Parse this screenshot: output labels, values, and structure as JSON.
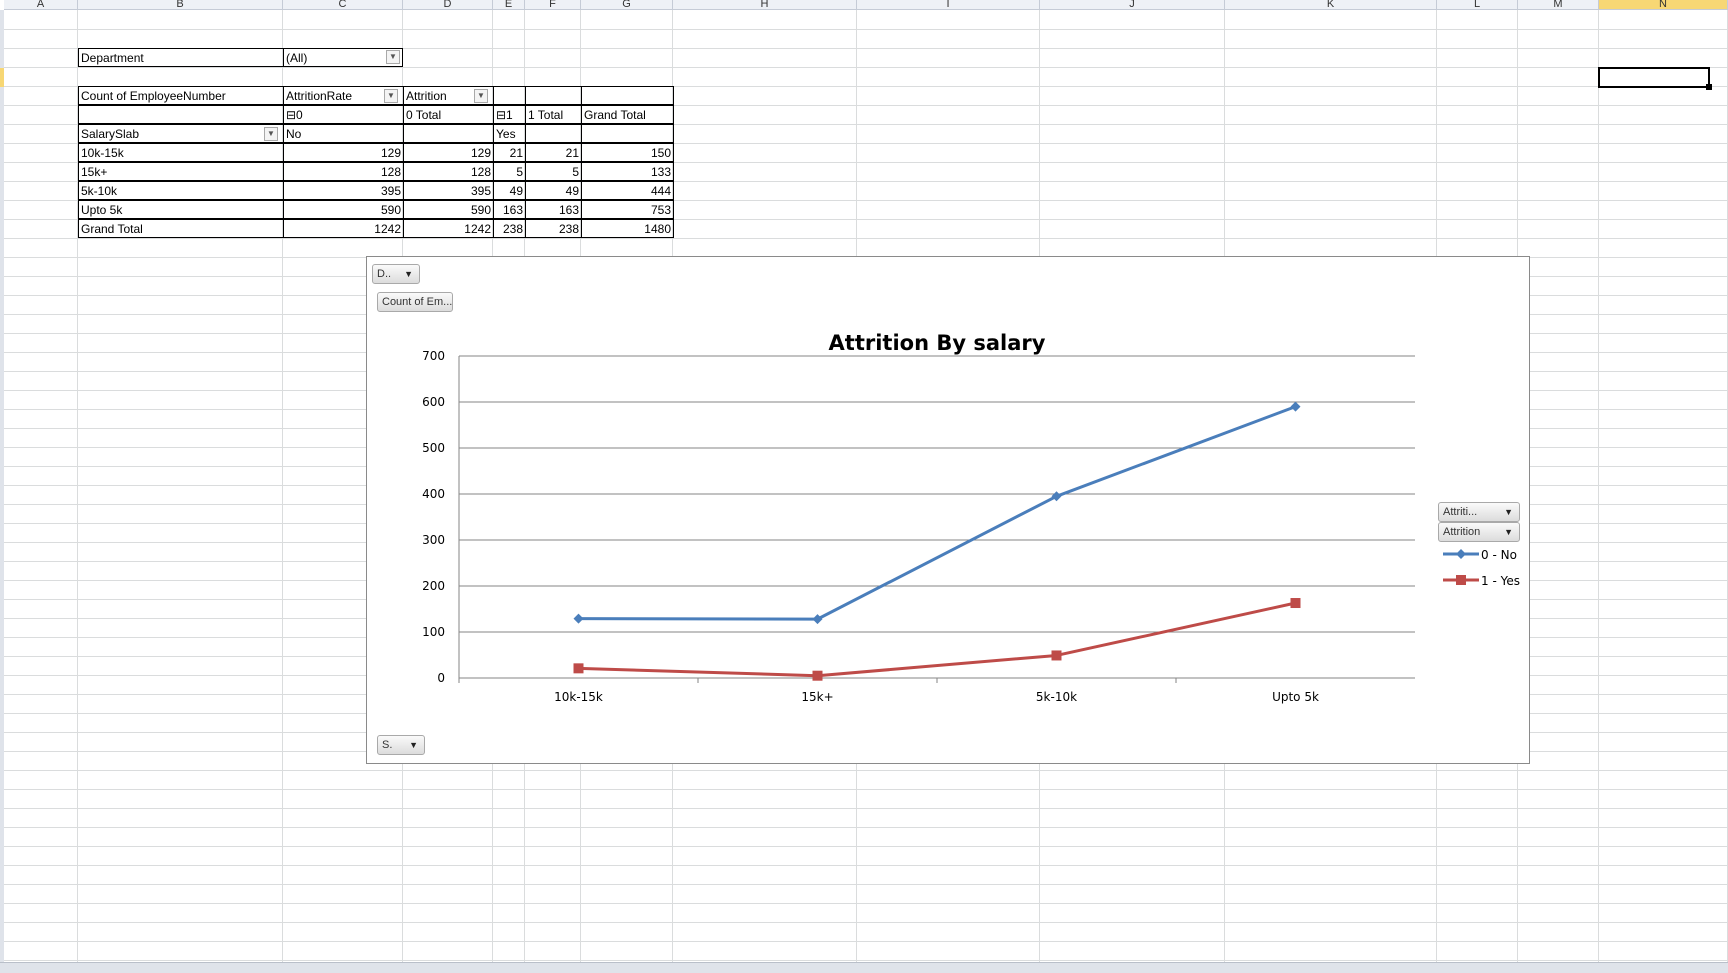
{
  "columns": [
    "A",
    "B",
    "C",
    "D",
    "E",
    "F",
    "G",
    "H",
    "I",
    "J",
    "K",
    "L",
    "M",
    "N"
  ],
  "selected_column": "N",
  "pivot": {
    "filter_label": "Department",
    "filter_value": "(All)",
    "values_label": "Count of EmployeeNumber",
    "col_field_1": "AttritionRate",
    "col_field_2": "Attrition",
    "group0_label": "⊟0",
    "group0_total": "0 Total",
    "group1_label": "⊟1",
    "group1_total": "1 Total",
    "grand_total_label": "Grand Total",
    "row_field": "SalarySlab",
    "sub_no": "No",
    "sub_yes": "Yes",
    "rows": [
      {
        "label": "10k-15k",
        "no": "129",
        "no_total": "129",
        "yes": "21",
        "yes_total": "21",
        "grand": "150"
      },
      {
        "label": "15k+",
        "no": "128",
        "no_total": "128",
        "yes": "5",
        "yes_total": "5",
        "grand": "133"
      },
      {
        "label": "5k-10k",
        "no": "395",
        "no_total": "395",
        "yes": "49",
        "yes_total": "49",
        "grand": "444"
      },
      {
        "label": "Upto 5k",
        "no": "590",
        "no_total": "590",
        "yes": "163",
        "yes_total": "163",
        "grand": "753"
      },
      {
        "label": "Grand Total",
        "no": "1242",
        "no_total": "1242",
        "yes": "238",
        "yes_total": "238",
        "grand": "1480"
      }
    ]
  },
  "chart_buttons": {
    "dept": "D..",
    "values": "Count of Em...",
    "axis": "S.",
    "legend1": "Attriti...",
    "legend2": "Attrition"
  },
  "chart_data": {
    "type": "line",
    "title": "Attrition By salary",
    "categories": [
      "10k-15k",
      "15k+",
      "5k-10k",
      "Upto 5k"
    ],
    "series": [
      {
        "name": "0 - No",
        "values": [
          129,
          128,
          395,
          590
        ],
        "color": "#4a7ebb",
        "marker": "diamond"
      },
      {
        "name": "1 - Yes",
        "values": [
          21,
          5,
          49,
          163
        ],
        "color": "#be4b48",
        "marker": "square"
      }
    ],
    "ylim": [
      0,
      700
    ],
    "yticks": [
      0,
      100,
      200,
      300,
      400,
      500,
      600,
      700
    ],
    "grid": true,
    "legend_position": "right"
  }
}
